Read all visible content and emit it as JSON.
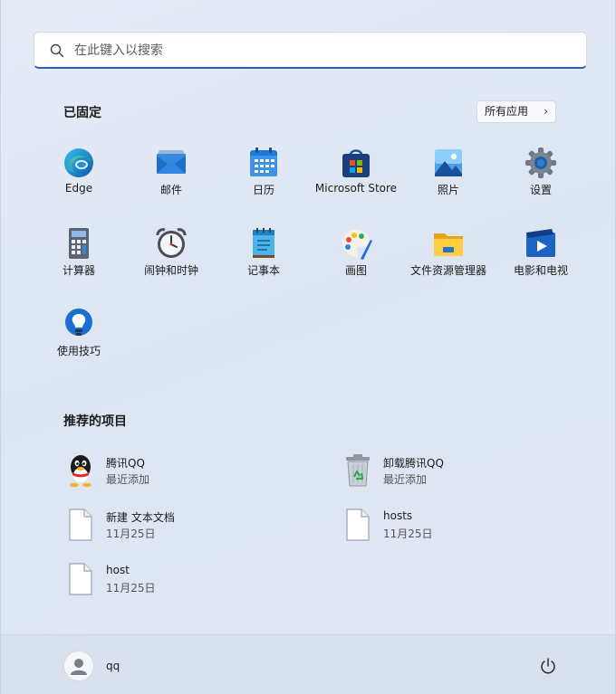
{
  "search": {
    "placeholder": "在此键入以搜索"
  },
  "pinned": {
    "title": "已固定",
    "all_apps_label": "所有应用",
    "apps": [
      {
        "label": "Edge",
        "icon": "edge-icon"
      },
      {
        "label": "邮件",
        "icon": "mail-icon"
      },
      {
        "label": "日历",
        "icon": "calendar-icon"
      },
      {
        "label": "Microsoft Store",
        "icon": "store-icon"
      },
      {
        "label": "照片",
        "icon": "photos-icon"
      },
      {
        "label": "设置",
        "icon": "gear-icon"
      },
      {
        "label": "计算器",
        "icon": "calculator-icon"
      },
      {
        "label": "闹钟和时钟",
        "icon": "alarm-clock-icon"
      },
      {
        "label": "记事本",
        "icon": "notepad-icon"
      },
      {
        "label": "画图",
        "icon": "paint-palette-icon"
      },
      {
        "label": "文件资源管理器",
        "icon": "folder-icon"
      },
      {
        "label": "电影和电视",
        "icon": "movies-icon"
      },
      {
        "label": "使用技巧",
        "icon": "tips-lightbulb-icon"
      }
    ]
  },
  "recommended": {
    "title": "推荐的项目",
    "items": [
      {
        "name": "腾讯QQ",
        "sub": "最近添加",
        "icon": "qq-penguin-icon"
      },
      {
        "name": "卸载腾讯QQ",
        "sub": "最近添加",
        "icon": "recycle-bin-icon"
      },
      {
        "name": "新建 文本文档",
        "sub": "11月25日",
        "icon": "file-icon"
      },
      {
        "name": "hosts",
        "sub": "11月25日",
        "icon": "file-icon"
      },
      {
        "name": "host",
        "sub": "11月25日",
        "icon": "file-icon"
      }
    ]
  },
  "footer": {
    "username": "qq"
  },
  "colors": {
    "accent": "#2b5fb0",
    "background": "#dfe6f1"
  }
}
